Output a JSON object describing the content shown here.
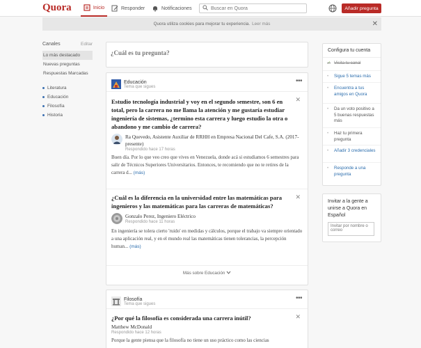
{
  "header": {
    "logo": "Quora",
    "nav": [
      {
        "label": "Inicio"
      },
      {
        "label": "Responder"
      },
      {
        "label": "Notificaciones"
      }
    ],
    "search_placeholder": "Buscar en Quora",
    "ask_button": "Añadir pregunta",
    "accent": "#b92b27"
  },
  "cookie": {
    "text": "Quora utiliza cookies para mejorar tu experiencia.",
    "link": "Leer más",
    "close": "✕"
  },
  "sidebar": {
    "title": "Canales",
    "edit": "Editar",
    "items": [
      {
        "label": "Lo más destacado"
      },
      {
        "label": "Nuevas preguntas"
      },
      {
        "label": "Respuestas Marcadas"
      }
    ],
    "topics": [
      {
        "label": "Literatura"
      },
      {
        "label": "Educación"
      },
      {
        "label": "Filosofía"
      },
      {
        "label": "Historia"
      }
    ]
  },
  "feed": {
    "ask_prompt": "¿Cuál es tu pregunta?",
    "cards": [
      {
        "topic": "Educación",
        "topic_sub": "Tema que sigues",
        "more_label": "Más sobre Educación",
        "questions": [
          {
            "title": "Estudio tecnología industrial y voy en el segundo semestre, son 6 en total, pero la carrera no me llama la atención y me gustaría estudiar ingeniería de sistemas, ¿termino esta carrera y luego estudio la otra o abandono y me cambio de carrera?",
            "author": "Ra Quevedo, Asistente Auxiliar de RRHH en Empresa Nacional Del Cafe, S.A. (2017-presente)",
            "time": "Respondido hace 17 horas",
            "answer": "Buen día. Por lo que veo creo que vives en Venezuela, donde acá si estudiamos 6 semestres para salir de Técnicos Superiores Universitarios. Entonces, te recomiendo que no te retires de la carrera d...",
            "more": "(más)"
          },
          {
            "title": "¿Cuál es la diferencia en la universidad entre las matemáticas para ingenieros y las matemáticas para las carreras de matemáticas?",
            "author": "Gonzalo Perez, Ingeniero Eléctrico",
            "time": "Respondido hace 11 horas",
            "answer": "En ingeniería se tolera cierto 'ruido' en medidas y cálculos, porque el trabajo va siempre orientado a una aplicación real, y en el mundo real las matemáticas tienen tolerancias, la percepción human...",
            "more": "(más)"
          }
        ]
      },
      {
        "topic": "Filosofía",
        "topic_sub": "Tema que sigues",
        "questions": [
          {
            "title": "¿Por qué la filosofía es considerada una carrera inútil?",
            "author": "Matthew McDonald",
            "time": "Respondido hace 12 horas",
            "answer": "Porque la gente piensa que la filosofía no tiene un uso práctico como las ciencias"
          }
        ]
      }
    ]
  },
  "right": {
    "setup_title": "Configura tu cuenta",
    "steps": [
      {
        "label": "Visita tu canal",
        "done": true
      },
      {
        "label": "Sigue 5 temas más",
        "done": false
      },
      {
        "label": "Encuentra a tus amigos en Quora",
        "done": false
      },
      {
        "label": "Da un voto positivo a 5 buenas respuestas más",
        "done": false,
        "plain": true
      },
      {
        "label": "Haz tu primera pregunta",
        "done": false,
        "plain": true
      },
      {
        "label": "Añadir 3 credenciales",
        "done": false
      },
      {
        "label": "Responde a una pregunta",
        "done": false
      }
    ],
    "invite_title": "Invitar a la gente a unirse a Quora en Español",
    "invite_placeholder": "Invitar por nombre o correo"
  }
}
